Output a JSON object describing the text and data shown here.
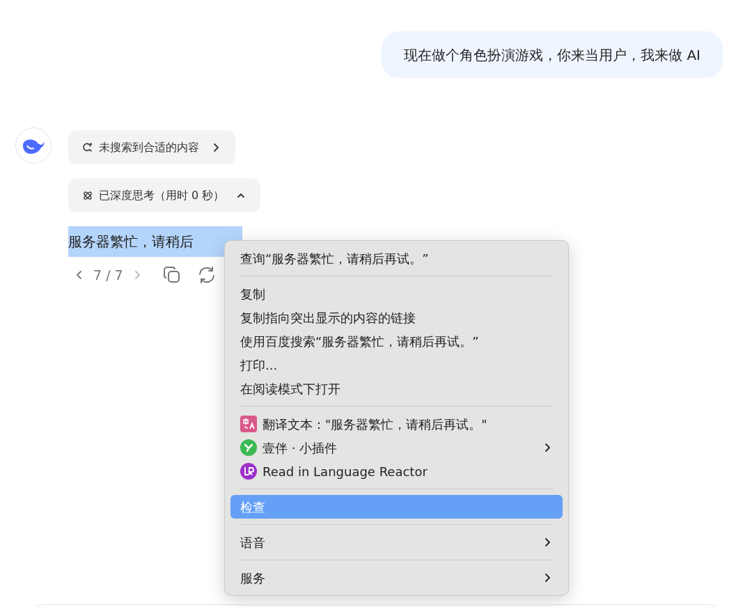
{
  "user_message": {
    "text": "现在做个角色扮演游戏，你来当用户，我来做 AI"
  },
  "assistant": {
    "chips": [
      {
        "kind": "search",
        "label": "未搜索到合适的内容",
        "expanded": false
      },
      {
        "kind": "think",
        "label": "已深度思考（用时 0 秒）",
        "expanded": true
      }
    ],
    "reply": {
      "text": "服务器繁忙，请稍后",
      "selected": true
    },
    "pager": {
      "text": "7 / 7"
    }
  },
  "context_menu": {
    "groups": [
      [
        {
          "label": "查询“服务器繁忙，请稍后再试。”",
          "selected": false,
          "submenu": false
        }
      ],
      [
        {
          "label": "复制",
          "selected": false,
          "submenu": false
        },
        {
          "label": "复制指向突出显示的内容的链接",
          "selected": false,
          "submenu": false
        },
        {
          "label": "使用百度搜索“服务器繁忙，请稍后再试。”",
          "selected": false,
          "submenu": false
        },
        {
          "label": "打印...",
          "selected": false,
          "submenu": false
        },
        {
          "label": "在阅读模式下打开",
          "selected": false,
          "submenu": false
        }
      ],
      [
        {
          "label": "翻译文本：\"服务器繁忙，请稍后再试。\"",
          "selected": false,
          "submenu": false,
          "kind": "translate"
        },
        {
          "label": "壹伴 · 小插件",
          "selected": false,
          "submenu": true,
          "kind": "yiban"
        },
        {
          "label": "Read in Language Reactor",
          "selected": false,
          "submenu": false,
          "kind": "reactor"
        }
      ],
      [
        {
          "label": "检查",
          "selected": true,
          "submenu": false
        }
      ],
      [
        {
          "label": "语音",
          "selected": false,
          "submenu": true
        }
      ],
      [
        {
          "label": "服务",
          "selected": false,
          "submenu": true
        }
      ]
    ]
  }
}
